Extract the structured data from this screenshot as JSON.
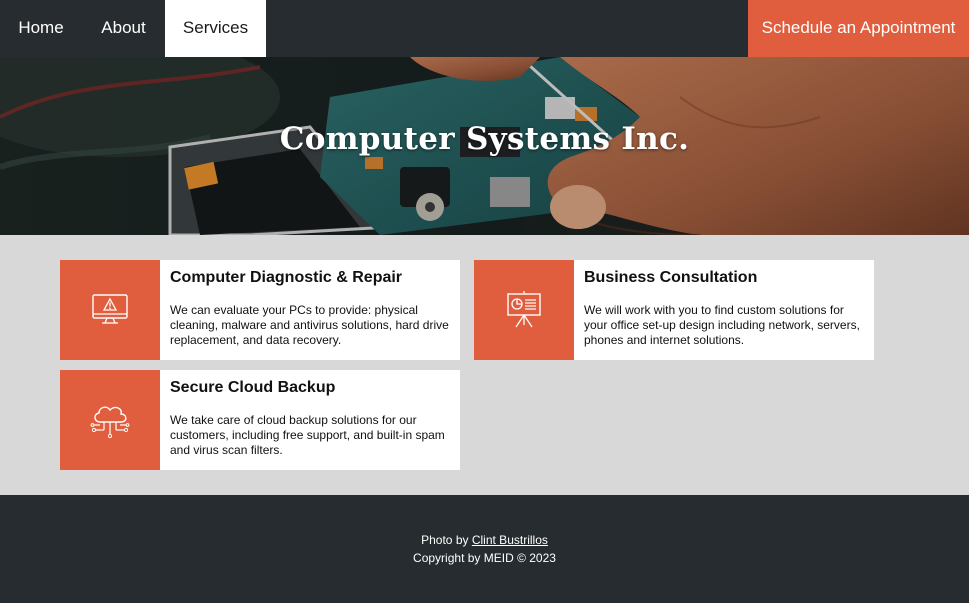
{
  "nav": {
    "home": "Home",
    "about": "About",
    "services": "Services",
    "cta": "Schedule an Appointment"
  },
  "hero": {
    "title": "Computer Systems Inc."
  },
  "services": [
    {
      "title": "Computer Diagnostic & Repair",
      "text": "We can evaluate your PCs to provide: physical cleaning, malware and antivirus solutions, hard drive replacement, and data recovery.",
      "icon": "computer-warning-icon"
    },
    {
      "title": "Business Consultation",
      "text": "We will work with you to find custom solutions for your office set-up design including network, servers, phones and internet solutions.",
      "icon": "presentation-board-icon"
    },
    {
      "title": "Secure Cloud Backup",
      "text": "We take care of cloud backup solutions for our customers, including free support, and built-in spam and virus scan filters.",
      "icon": "cloud-network-icon"
    }
  ],
  "footer": {
    "photo_prefix": "Photo by",
    "photo_author": "Clint Bustrillos",
    "copyright": "Copyright by MEID © 2023"
  },
  "colors": {
    "accent": "#e05d3d",
    "dark": "#262c2f",
    "background": "#d8d8d8"
  }
}
